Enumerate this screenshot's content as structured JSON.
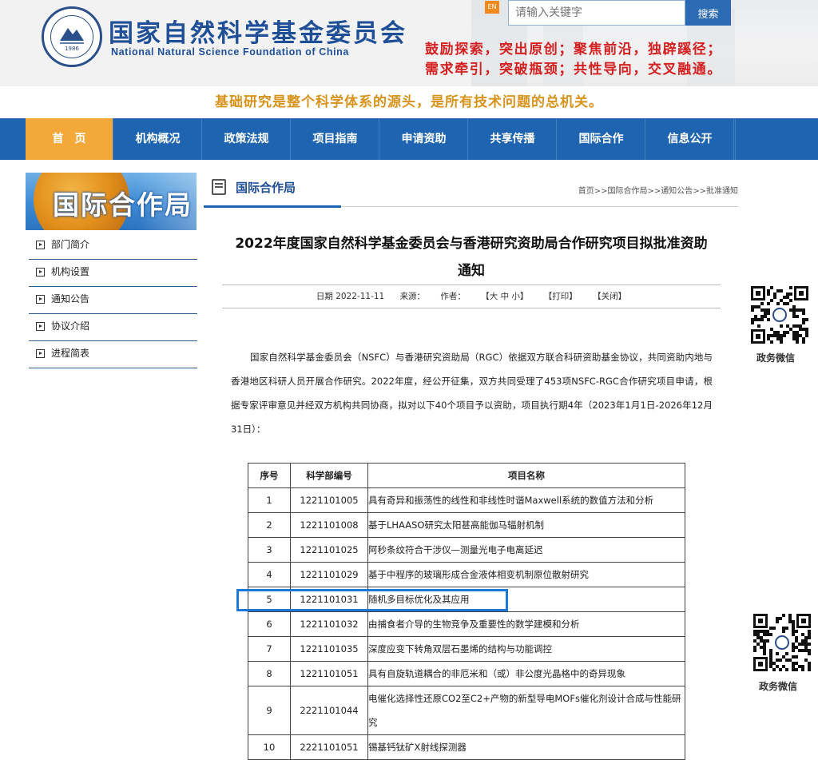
{
  "header": {
    "org_cn": "国家自然科学基金委员会",
    "org_en": "National Natural Science Foundation of China",
    "seal_year": "1986",
    "lang_badge": "EN",
    "search_placeholder": "请输入关键字",
    "search_button": "搜索",
    "slogan_line1": "鼓励探索，突出原创；聚焦前沿，独辟蹊径；",
    "slogan_line2": "需求牵引，突破瓶颈；共性导向，交叉融通。",
    "subslogan": "基础研究是整个科学体系的源头，是所有技术问题的总机关。"
  },
  "nav": {
    "items": [
      "首　页",
      "机构概况",
      "政策法规",
      "项目指南",
      "申请资助",
      "共享传播",
      "国际合作",
      "信息公开"
    ],
    "active_index": 0
  },
  "sidebar": {
    "banner_title": "国际合作局",
    "items": [
      "部门简介",
      "机构设置",
      "通知公告",
      "协议介绍",
      "进程简表"
    ]
  },
  "section": {
    "title": "国际合作局",
    "breadcrumb": "首页>>国际合作局>>通知公告>>批准通知"
  },
  "article": {
    "title_line1": "2022年度国家自然科学基金委员会与香港研究资助局合作研究项目拟批准资助",
    "title_line2": "通知",
    "date": "日期 2022-11-11",
    "source": "来源：",
    "author": "作者：",
    "font_size_ctrl": "【大 中 小】",
    "print": "【打印】",
    "close": "【关闭】",
    "body": "国家自然科学基金委员会（NSFC）与香港研究资助局（RGC）依据双方联合科研资助基金协议，共同资助内地与香港地区科研人员开展合作研究。2022年度，经公开征集，双方共同受理了453项NSFC-RGC合作研究项目申请，根据专家评审意见并经双方机构共同协商，拟对以下40个项目予以资助，项目执行期4年（2023年1月1日-2026年12月31日）："
  },
  "table": {
    "headers": [
      "序号",
      "科学部编号",
      "项目名称"
    ],
    "rows": [
      [
        "1",
        "1221101005",
        "具有奇异和振荡性的线性和非线性时谐Maxwell系统的数值方法和分析"
      ],
      [
        "2",
        "1221101008",
        "基于LHAASO研究太阳甚高能伽马辐射机制"
      ],
      [
        "3",
        "1221101025",
        "阿秒条纹符合干涉仪—测量光电子电离延迟"
      ],
      [
        "4",
        "1221101029",
        "基于中程序的玻璃形成合金液体相变机制原位散射研究"
      ],
      [
        "5",
        "1221101031",
        "随机多目标优化及其应用"
      ],
      [
        "6",
        "1221101032",
        "由捕食者介导的生物竞争及重要性的数学建模和分析"
      ],
      [
        "7",
        "1221101035",
        "深度应变下转角双层石墨烯的结构与功能调控"
      ],
      [
        "8",
        "1221101051",
        "具有自旋轨道耦合的非厄米和（或）非公度光晶格中的奇异现象"
      ],
      [
        "9",
        "2221101044",
        "电催化选择性还原CO2至C2+产物的新型导电MOFs催化剂设计合成与性能研究"
      ],
      [
        "10",
        "2221101051",
        "锡基钙钛矿X射线探测器"
      ]
    ],
    "highlighted_row": 5
  },
  "qr": {
    "label_top": "政务微信",
    "label_bottom": "政务微信"
  },
  "colors": {
    "nav_blue": "#1f64b0",
    "nav_active": "#f2a93a",
    "slogan_red": "#d42020",
    "subslogan_gold": "#d7931c",
    "brand_blue": "#1f4f96",
    "highlight_blue": "#1e76d6"
  }
}
